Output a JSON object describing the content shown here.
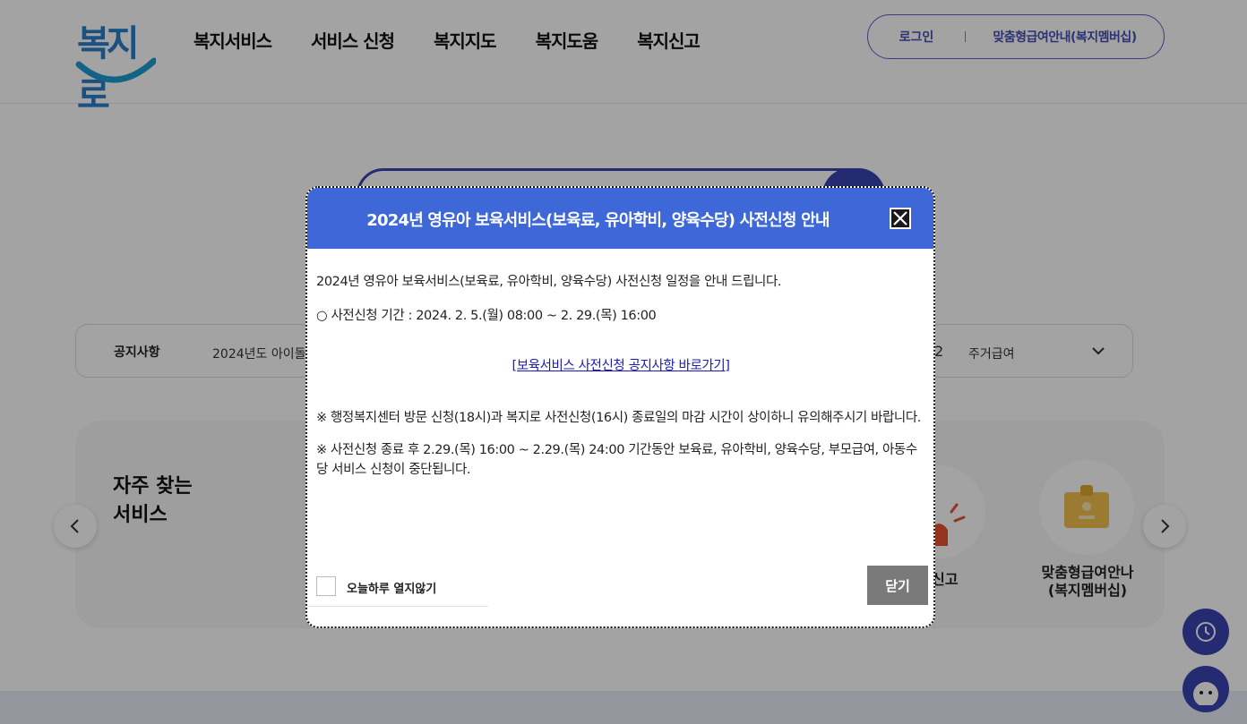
{
  "header": {
    "logo_text": "복지로",
    "nav": [
      "복지서비스",
      "서비스 신청",
      "복지지도",
      "복지도움",
      "복지신고"
    ],
    "login_label": "로그인",
    "member_label": "맞춤형급여안내(복지멤버십)"
  },
  "notice": {
    "label": "공지사항",
    "text": "2024년도 아이돌",
    "number": "2",
    "category": "주거급여"
  },
  "favorites": {
    "title": "자주 찾는\n서비스",
    "items": [
      {
        "label": "신고"
      },
      {
        "label": "맞춤형급여안나\n(복지멤버십)"
      }
    ]
  },
  "modal": {
    "title": "2024년 영유아 보육서비스(보육료, 유아학비, 양육수당) 사전신청 안내",
    "intro": "2024년 영유아 보육서비스(보육료, 유아학비, 양육수당) 사전신청 일정을 안내 드립니다.",
    "period": "○ 사전신청 기간 : 2024. 2. 5.(월) 08:00 ~ 2. 29.(목) 16:00",
    "link": "[보육서비스 사전신청 공지사항 바로가기]",
    "note1": "※ 행정복지센터 방문 신청(18시)과 복지로 사전신청(16시) 종료일의 마감 시간이 상이하니 유의해주시기 바랍니다.",
    "note2": "※ 사전신청 종료 후 2.29.(목) 16:00 ~ 2.29.(목) 24:00 기간동안 보육료, 유아학비, 양육수당, 부모급여, 아동수당 서비스 신청이 중단됩니다.",
    "dont_show_label": "오늘하루 열지않기",
    "close_label": "닫기"
  },
  "colors": {
    "primary": "#3a44b0",
    "modal_header": "#3e68d8"
  }
}
